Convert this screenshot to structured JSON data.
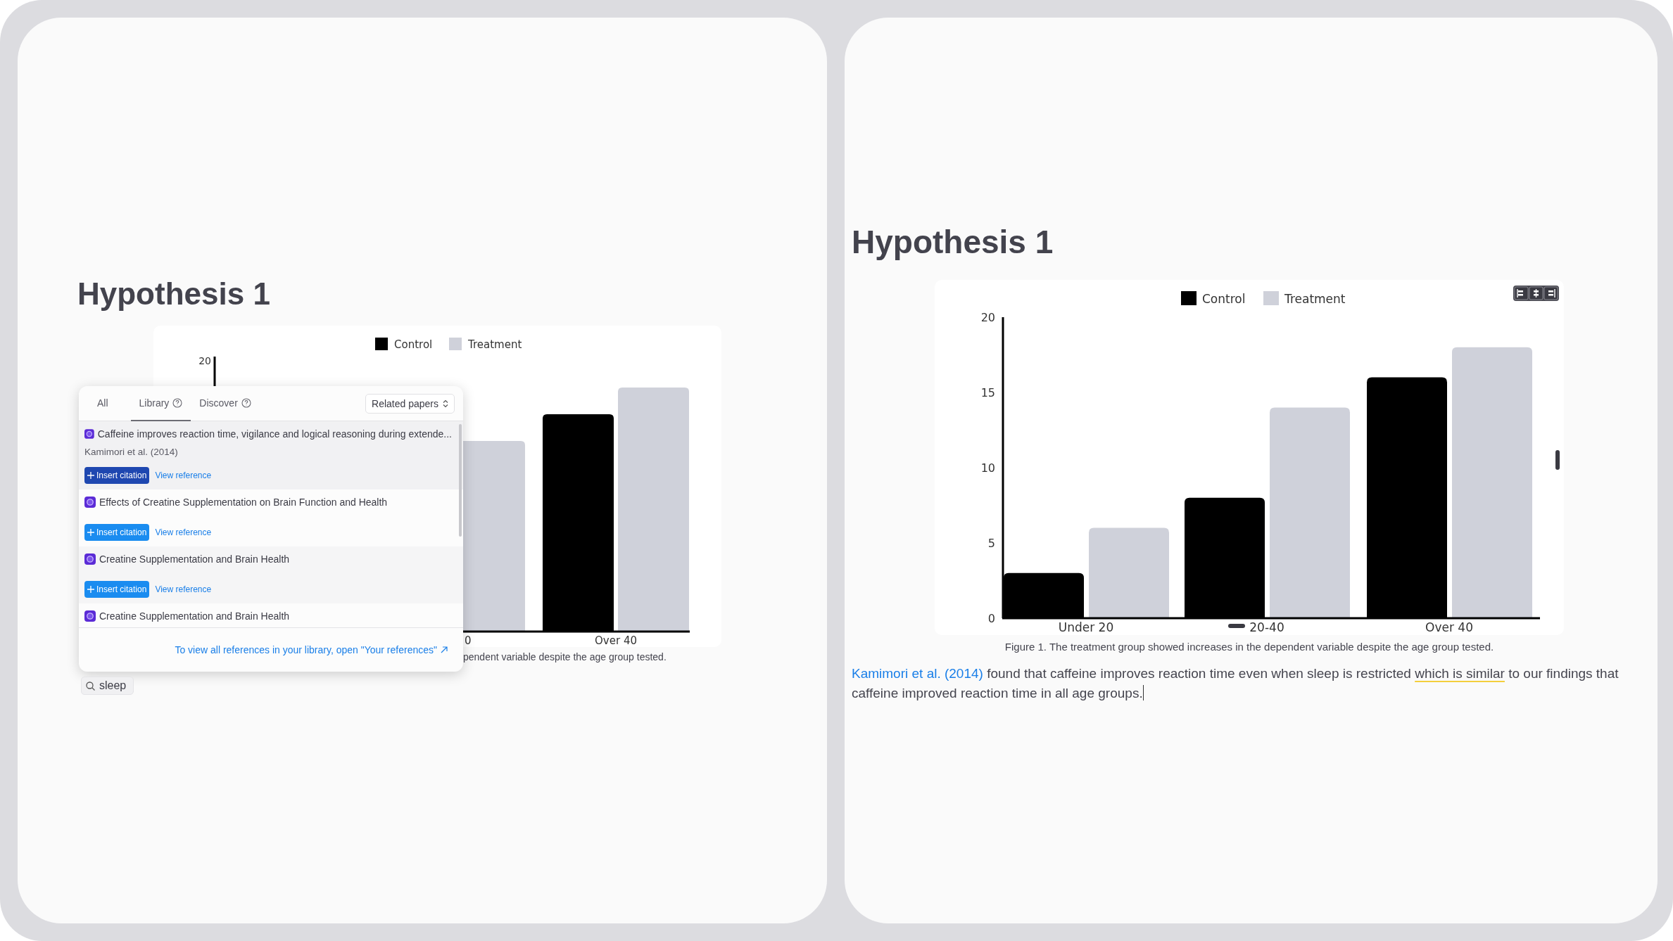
{
  "left_panel": {
    "heading": "Hypothesis 1",
    "chart": {
      "legend": [
        {
          "label": "Control",
          "color": "#000000"
        },
        {
          "label": "Treatment",
          "color": "#cfd1da"
        }
      ],
      "y_tick": "20",
      "x_labels": [
        "0",
        "Over 40"
      ],
      "caption": "pendent variable despite the age group tested."
    },
    "reference_popup": {
      "tabs": [
        {
          "label": "All",
          "selected": false,
          "help": false
        },
        {
          "label": "Library",
          "selected": true,
          "help": true
        },
        {
          "label": "Discover",
          "selected": false,
          "help": true
        }
      ],
      "sort_dropdown": "Related papers",
      "references": [
        {
          "title": "Caffeine improves reaction time, vigilance and logical reasoning during extende...",
          "authors": "Kamimori et al. (2014)",
          "insert_label": "Insert citation",
          "view_label": "View reference",
          "hovered": true
        },
        {
          "title": "Effects of Creatine Supplementation on Brain Function and Health",
          "insert_label": "Insert citation",
          "view_label": "View reference",
          "hovered": false
        },
        {
          "title": "Creatine Supplementation and Brain Health",
          "insert_label": "Insert citation",
          "view_label": "View reference",
          "hovered": false
        },
        {
          "title": "Creatine Supplementation and Brain Health"
        }
      ],
      "footer_link": "To view all references in your library, open \"Your references\""
    },
    "search_chip": {
      "value": "sleep"
    }
  },
  "right_panel": {
    "heading": "Hypothesis 1",
    "chart": {
      "chart_data": {
        "type": "bar",
        "categories": [
          "Under 20",
          "20-40",
          "Over 40"
        ],
        "series": [
          {
            "name": "Control",
            "color": "#000000",
            "values": [
              3,
              8,
              16
            ]
          },
          {
            "name": "Treatment",
            "color": "#cfd1da",
            "values": [
              6,
              14,
              18
            ]
          }
        ],
        "ylim": [
          0,
          20
        ],
        "yticks": [
          0,
          5,
          10,
          15,
          20
        ],
        "legend": "top"
      },
      "caption": "Figure 1. The treatment group showed increases in the dependent variable despite the age group tested."
    },
    "paragraph": [
      {
        "kind": "link",
        "text": "Kamimori et al. (2014)"
      },
      {
        "kind": "plain",
        "text": " found that caffeine improves reaction time even when sleep is restricted "
      },
      {
        "kind": "highlight",
        "text": "which is similar"
      },
      {
        "kind": "plain",
        "text": " to our findings that caffeine improved reaction time in all age groups."
      }
    ]
  }
}
